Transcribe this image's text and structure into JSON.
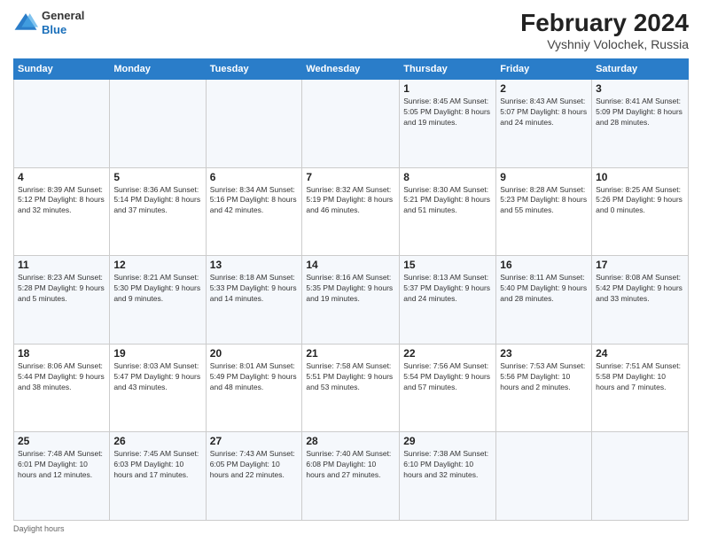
{
  "header": {
    "logo": {
      "general": "General",
      "blue": "Blue"
    },
    "title": "February 2024",
    "location": "Vyshniy Volochek, Russia"
  },
  "columns": [
    "Sunday",
    "Monday",
    "Tuesday",
    "Wednesday",
    "Thursday",
    "Friday",
    "Saturday"
  ],
  "weeks": [
    [
      {
        "day": "",
        "info": ""
      },
      {
        "day": "",
        "info": ""
      },
      {
        "day": "",
        "info": ""
      },
      {
        "day": "",
        "info": ""
      },
      {
        "day": "1",
        "info": "Sunrise: 8:45 AM\nSunset: 5:05 PM\nDaylight: 8 hours and 19 minutes."
      },
      {
        "day": "2",
        "info": "Sunrise: 8:43 AM\nSunset: 5:07 PM\nDaylight: 8 hours and 24 minutes."
      },
      {
        "day": "3",
        "info": "Sunrise: 8:41 AM\nSunset: 5:09 PM\nDaylight: 8 hours and 28 minutes."
      }
    ],
    [
      {
        "day": "4",
        "info": "Sunrise: 8:39 AM\nSunset: 5:12 PM\nDaylight: 8 hours and 32 minutes."
      },
      {
        "day": "5",
        "info": "Sunrise: 8:36 AM\nSunset: 5:14 PM\nDaylight: 8 hours and 37 minutes."
      },
      {
        "day": "6",
        "info": "Sunrise: 8:34 AM\nSunset: 5:16 PM\nDaylight: 8 hours and 42 minutes."
      },
      {
        "day": "7",
        "info": "Sunrise: 8:32 AM\nSunset: 5:19 PM\nDaylight: 8 hours and 46 minutes."
      },
      {
        "day": "8",
        "info": "Sunrise: 8:30 AM\nSunset: 5:21 PM\nDaylight: 8 hours and 51 minutes."
      },
      {
        "day": "9",
        "info": "Sunrise: 8:28 AM\nSunset: 5:23 PM\nDaylight: 8 hours and 55 minutes."
      },
      {
        "day": "10",
        "info": "Sunrise: 8:25 AM\nSunset: 5:26 PM\nDaylight: 9 hours and 0 minutes."
      }
    ],
    [
      {
        "day": "11",
        "info": "Sunrise: 8:23 AM\nSunset: 5:28 PM\nDaylight: 9 hours and 5 minutes."
      },
      {
        "day": "12",
        "info": "Sunrise: 8:21 AM\nSunset: 5:30 PM\nDaylight: 9 hours and 9 minutes."
      },
      {
        "day": "13",
        "info": "Sunrise: 8:18 AM\nSunset: 5:33 PM\nDaylight: 9 hours and 14 minutes."
      },
      {
        "day": "14",
        "info": "Sunrise: 8:16 AM\nSunset: 5:35 PM\nDaylight: 9 hours and 19 minutes."
      },
      {
        "day": "15",
        "info": "Sunrise: 8:13 AM\nSunset: 5:37 PM\nDaylight: 9 hours and 24 minutes."
      },
      {
        "day": "16",
        "info": "Sunrise: 8:11 AM\nSunset: 5:40 PM\nDaylight: 9 hours and 28 minutes."
      },
      {
        "day": "17",
        "info": "Sunrise: 8:08 AM\nSunset: 5:42 PM\nDaylight: 9 hours and 33 minutes."
      }
    ],
    [
      {
        "day": "18",
        "info": "Sunrise: 8:06 AM\nSunset: 5:44 PM\nDaylight: 9 hours and 38 minutes."
      },
      {
        "day": "19",
        "info": "Sunrise: 8:03 AM\nSunset: 5:47 PM\nDaylight: 9 hours and 43 minutes."
      },
      {
        "day": "20",
        "info": "Sunrise: 8:01 AM\nSunset: 5:49 PM\nDaylight: 9 hours and 48 minutes."
      },
      {
        "day": "21",
        "info": "Sunrise: 7:58 AM\nSunset: 5:51 PM\nDaylight: 9 hours and 53 minutes."
      },
      {
        "day": "22",
        "info": "Sunrise: 7:56 AM\nSunset: 5:54 PM\nDaylight: 9 hours and 57 minutes."
      },
      {
        "day": "23",
        "info": "Sunrise: 7:53 AM\nSunset: 5:56 PM\nDaylight: 10 hours and 2 minutes."
      },
      {
        "day": "24",
        "info": "Sunrise: 7:51 AM\nSunset: 5:58 PM\nDaylight: 10 hours and 7 minutes."
      }
    ],
    [
      {
        "day": "25",
        "info": "Sunrise: 7:48 AM\nSunset: 6:01 PM\nDaylight: 10 hours and 12 minutes."
      },
      {
        "day": "26",
        "info": "Sunrise: 7:45 AM\nSunset: 6:03 PM\nDaylight: 10 hours and 17 minutes."
      },
      {
        "day": "27",
        "info": "Sunrise: 7:43 AM\nSunset: 6:05 PM\nDaylight: 10 hours and 22 minutes."
      },
      {
        "day": "28",
        "info": "Sunrise: 7:40 AM\nSunset: 6:08 PM\nDaylight: 10 hours and 27 minutes."
      },
      {
        "day": "29",
        "info": "Sunrise: 7:38 AM\nSunset: 6:10 PM\nDaylight: 10 hours and 32 minutes."
      },
      {
        "day": "",
        "info": ""
      },
      {
        "day": "",
        "info": ""
      }
    ]
  ],
  "footer": "Daylight hours"
}
